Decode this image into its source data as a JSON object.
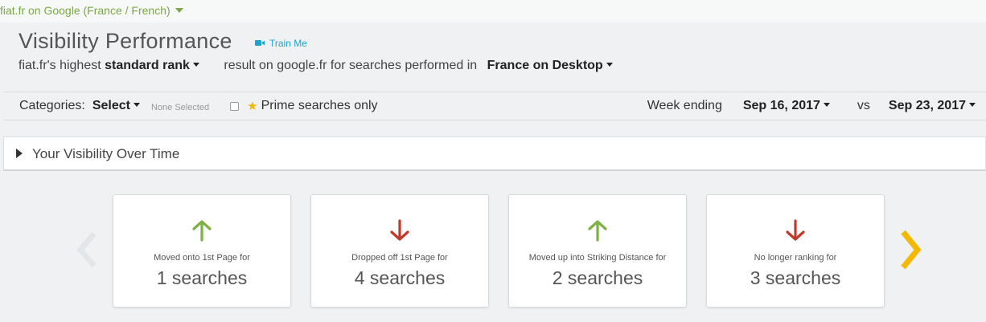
{
  "top": {
    "site_selector": "fiat.fr on Google (France / French)"
  },
  "header": {
    "title": "Visibility Performance",
    "train_me": "Train Me",
    "sub_prefix": "fiat.fr's highest",
    "rank_type": "standard rank",
    "sub_middle": "result on google.fr for searches performed in",
    "location_device": "France on Desktop"
  },
  "filters": {
    "categories_label": "Categories:",
    "categories_select": "Select",
    "none_selected": "None Selected",
    "prime_label": "Prime searches only",
    "prime_checked": false,
    "week_ending_label": "Week ending",
    "date_from": "Sep 16, 2017",
    "vs_label": "vs",
    "date_to": "Sep 23, 2017"
  },
  "panel": {
    "label": "Your Visibility Over Time",
    "expanded": false
  },
  "cards": [
    {
      "direction": "up",
      "label": "Moved onto 1st Page for",
      "value": "1 searches"
    },
    {
      "direction": "down",
      "label": "Dropped off 1st Page for",
      "value": "4 searches"
    },
    {
      "direction": "up",
      "label": "Moved up into Striking Distance for",
      "value": "2 searches"
    },
    {
      "direction": "down",
      "label": "No longer ranking for",
      "value": "3 searches"
    }
  ],
  "colors": {
    "up": "#7db143",
    "down": "#c0392b",
    "accent_green": "#7aa843",
    "link_blue": "#1fa2c9",
    "nav_active": "#f5b800",
    "nav_inactive": "#e3e6e8"
  },
  "icons": {
    "train_me": "video-camera-icon",
    "prime": "star-icon",
    "panel": "caret-right-icon",
    "prev": "chevron-left-icon",
    "next": "chevron-right-icon"
  }
}
